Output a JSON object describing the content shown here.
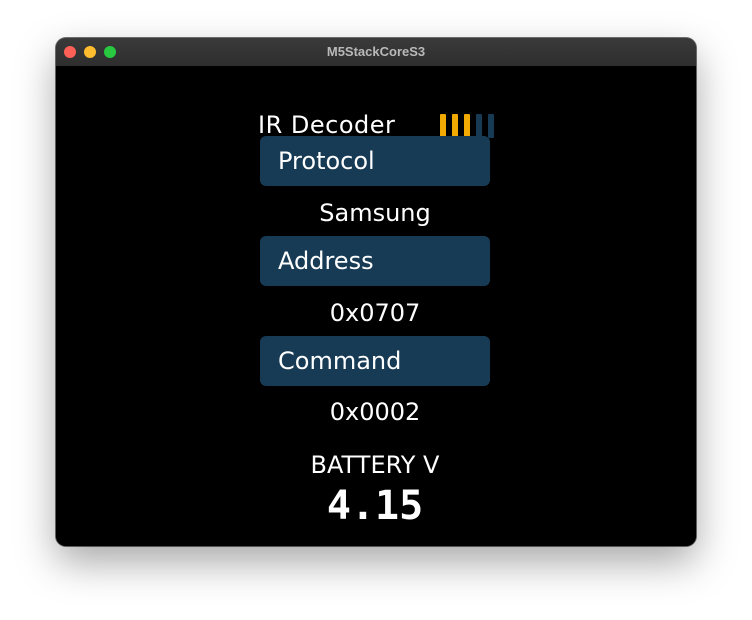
{
  "window": {
    "title": "M5StackCoreS3"
  },
  "header": {
    "title": "IR Decoder",
    "signal_level": 3,
    "signal_total": 5,
    "signal_active_color": "#f2a900",
    "signal_inactive_color": "#173a55"
  },
  "sections": [
    {
      "label": "Protocol",
      "value": "Samsung"
    },
    {
      "label": "Address",
      "value": "0x0707"
    },
    {
      "label": "Command",
      "value": "0x0002"
    }
  ],
  "battery": {
    "label": "BATTERY V",
    "value": "4.15"
  },
  "colors": {
    "background": "#000000",
    "section_header": "#173a55",
    "text": "#ffffff"
  }
}
